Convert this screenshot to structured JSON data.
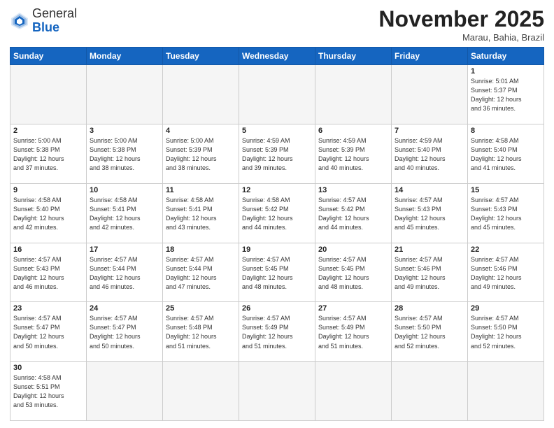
{
  "header": {
    "logo_general": "General",
    "logo_blue": "Blue",
    "month_title": "November 2025",
    "location": "Marau, Bahia, Brazil"
  },
  "weekdays": [
    "Sunday",
    "Monday",
    "Tuesday",
    "Wednesday",
    "Thursday",
    "Friday",
    "Saturday"
  ],
  "weeks": [
    [
      {
        "day": "",
        "info": ""
      },
      {
        "day": "",
        "info": ""
      },
      {
        "day": "",
        "info": ""
      },
      {
        "day": "",
        "info": ""
      },
      {
        "day": "",
        "info": ""
      },
      {
        "day": "",
        "info": ""
      },
      {
        "day": "1",
        "info": "Sunrise: 5:01 AM\nSunset: 5:37 PM\nDaylight: 12 hours\nand 36 minutes."
      }
    ],
    [
      {
        "day": "2",
        "info": "Sunrise: 5:00 AM\nSunset: 5:38 PM\nDaylight: 12 hours\nand 37 minutes."
      },
      {
        "day": "3",
        "info": "Sunrise: 5:00 AM\nSunset: 5:38 PM\nDaylight: 12 hours\nand 38 minutes."
      },
      {
        "day": "4",
        "info": "Sunrise: 5:00 AM\nSunset: 5:39 PM\nDaylight: 12 hours\nand 38 minutes."
      },
      {
        "day": "5",
        "info": "Sunrise: 4:59 AM\nSunset: 5:39 PM\nDaylight: 12 hours\nand 39 minutes."
      },
      {
        "day": "6",
        "info": "Sunrise: 4:59 AM\nSunset: 5:39 PM\nDaylight: 12 hours\nand 40 minutes."
      },
      {
        "day": "7",
        "info": "Sunrise: 4:59 AM\nSunset: 5:40 PM\nDaylight: 12 hours\nand 40 minutes."
      },
      {
        "day": "8",
        "info": "Sunrise: 4:58 AM\nSunset: 5:40 PM\nDaylight: 12 hours\nand 41 minutes."
      }
    ],
    [
      {
        "day": "9",
        "info": "Sunrise: 4:58 AM\nSunset: 5:40 PM\nDaylight: 12 hours\nand 42 minutes."
      },
      {
        "day": "10",
        "info": "Sunrise: 4:58 AM\nSunset: 5:41 PM\nDaylight: 12 hours\nand 42 minutes."
      },
      {
        "day": "11",
        "info": "Sunrise: 4:58 AM\nSunset: 5:41 PM\nDaylight: 12 hours\nand 43 minutes."
      },
      {
        "day": "12",
        "info": "Sunrise: 4:58 AM\nSunset: 5:42 PM\nDaylight: 12 hours\nand 44 minutes."
      },
      {
        "day": "13",
        "info": "Sunrise: 4:57 AM\nSunset: 5:42 PM\nDaylight: 12 hours\nand 44 minutes."
      },
      {
        "day": "14",
        "info": "Sunrise: 4:57 AM\nSunset: 5:43 PM\nDaylight: 12 hours\nand 45 minutes."
      },
      {
        "day": "15",
        "info": "Sunrise: 4:57 AM\nSunset: 5:43 PM\nDaylight: 12 hours\nand 45 minutes."
      }
    ],
    [
      {
        "day": "16",
        "info": "Sunrise: 4:57 AM\nSunset: 5:43 PM\nDaylight: 12 hours\nand 46 minutes."
      },
      {
        "day": "17",
        "info": "Sunrise: 4:57 AM\nSunset: 5:44 PM\nDaylight: 12 hours\nand 46 minutes."
      },
      {
        "day": "18",
        "info": "Sunrise: 4:57 AM\nSunset: 5:44 PM\nDaylight: 12 hours\nand 47 minutes."
      },
      {
        "day": "19",
        "info": "Sunrise: 4:57 AM\nSunset: 5:45 PM\nDaylight: 12 hours\nand 48 minutes."
      },
      {
        "day": "20",
        "info": "Sunrise: 4:57 AM\nSunset: 5:45 PM\nDaylight: 12 hours\nand 48 minutes."
      },
      {
        "day": "21",
        "info": "Sunrise: 4:57 AM\nSunset: 5:46 PM\nDaylight: 12 hours\nand 49 minutes."
      },
      {
        "day": "22",
        "info": "Sunrise: 4:57 AM\nSunset: 5:46 PM\nDaylight: 12 hours\nand 49 minutes."
      }
    ],
    [
      {
        "day": "23",
        "info": "Sunrise: 4:57 AM\nSunset: 5:47 PM\nDaylight: 12 hours\nand 50 minutes."
      },
      {
        "day": "24",
        "info": "Sunrise: 4:57 AM\nSunset: 5:47 PM\nDaylight: 12 hours\nand 50 minutes."
      },
      {
        "day": "25",
        "info": "Sunrise: 4:57 AM\nSunset: 5:48 PM\nDaylight: 12 hours\nand 51 minutes."
      },
      {
        "day": "26",
        "info": "Sunrise: 4:57 AM\nSunset: 5:49 PM\nDaylight: 12 hours\nand 51 minutes."
      },
      {
        "day": "27",
        "info": "Sunrise: 4:57 AM\nSunset: 5:49 PM\nDaylight: 12 hours\nand 51 minutes."
      },
      {
        "day": "28",
        "info": "Sunrise: 4:57 AM\nSunset: 5:50 PM\nDaylight: 12 hours\nand 52 minutes."
      },
      {
        "day": "29",
        "info": "Sunrise: 4:57 AM\nSunset: 5:50 PM\nDaylight: 12 hours\nand 52 minutes."
      }
    ],
    [
      {
        "day": "30",
        "info": "Sunrise: 4:58 AM\nSunset: 5:51 PM\nDaylight: 12 hours\nand 53 minutes.",
        "last": true
      },
      {
        "day": "",
        "info": "",
        "last": true
      },
      {
        "day": "",
        "info": "",
        "last": true
      },
      {
        "day": "",
        "info": "",
        "last": true
      },
      {
        "day": "",
        "info": "",
        "last": true
      },
      {
        "day": "",
        "info": "",
        "last": true
      },
      {
        "day": "",
        "info": "",
        "last": true
      }
    ]
  ]
}
